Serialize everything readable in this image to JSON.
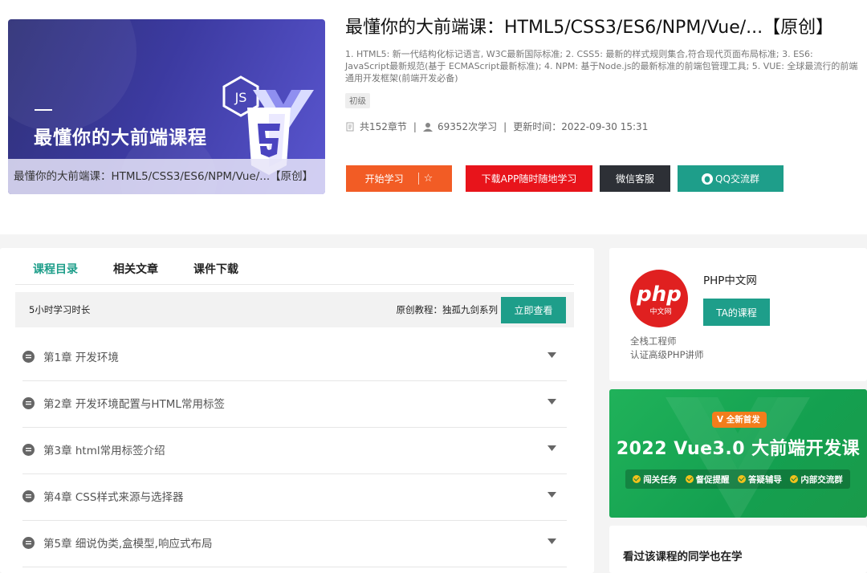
{
  "course": {
    "cover_title": "最懂你的大前端课程",
    "cover_caption": "最懂你的大前端课：HTML5/CSS3/ES6/NPM/Vue/...【原创】",
    "title": "最懂你的大前端课：HTML5/CSS3/ES6/NPM/Vue/...【原创】",
    "description": "1. HTML5: 新一代结构化标记语言, W3C最新国际标准; 2. CSS5: 最新的样式规则集合,符合现代页面布局标准; 3. ES6: JavaScript最新规范(基于 ECMAScript最新标准); 4. NPM: 基于Node.js的最新标准的前端包管理工具; 5. VUE: 全球最流行的前端通用开发框架(前端开发必备)",
    "level": "初级",
    "chapters_count": "共152章节",
    "learners": "69352次学习",
    "updated": "更新时间：2022-09-30 15:31"
  },
  "actions": {
    "start": "开始学习",
    "star": "☆",
    "download_app": "下载APP随时随地学习",
    "wechat": "微信客服",
    "qq": "QQ交流群"
  },
  "tabs": [
    "课程目录",
    "相关文章",
    "课件下载"
  ],
  "study_bar": {
    "duration": "5小时学习时长",
    "series": "原创教程：独孤九剑系列",
    "view_button": "立即查看"
  },
  "chapters": [
    "第1章 开发环境",
    "第2章 开发环境配置与HTML常用标签",
    "第3章 html常用标签介绍",
    "第4章 CSS样式来源与选择器",
    "第5章 细说伪类,盒模型,响应式布局"
  ],
  "teacher": {
    "logo_text": "php",
    "logo_sub": "中文网",
    "name": "PHP中文网",
    "button": "TA的课程",
    "line1": "全栈工程师",
    "line2": "认证高级PHP讲师"
  },
  "promo": {
    "badge": "全新首发",
    "title": "2022 Vue3.0 大前端开发课",
    "chips": [
      "闯关任务",
      "督促提醒",
      "答疑辅导",
      "内部交流群"
    ]
  },
  "also_learning": {
    "title": "看过该课程的同学也在学"
  },
  "colors": {
    "accent": "#1e9e8a",
    "start": "#f25c25",
    "app": "#e8141b",
    "wechat": "#2d3036",
    "promo_green": "#14a050",
    "logo_red": "#e02020"
  }
}
